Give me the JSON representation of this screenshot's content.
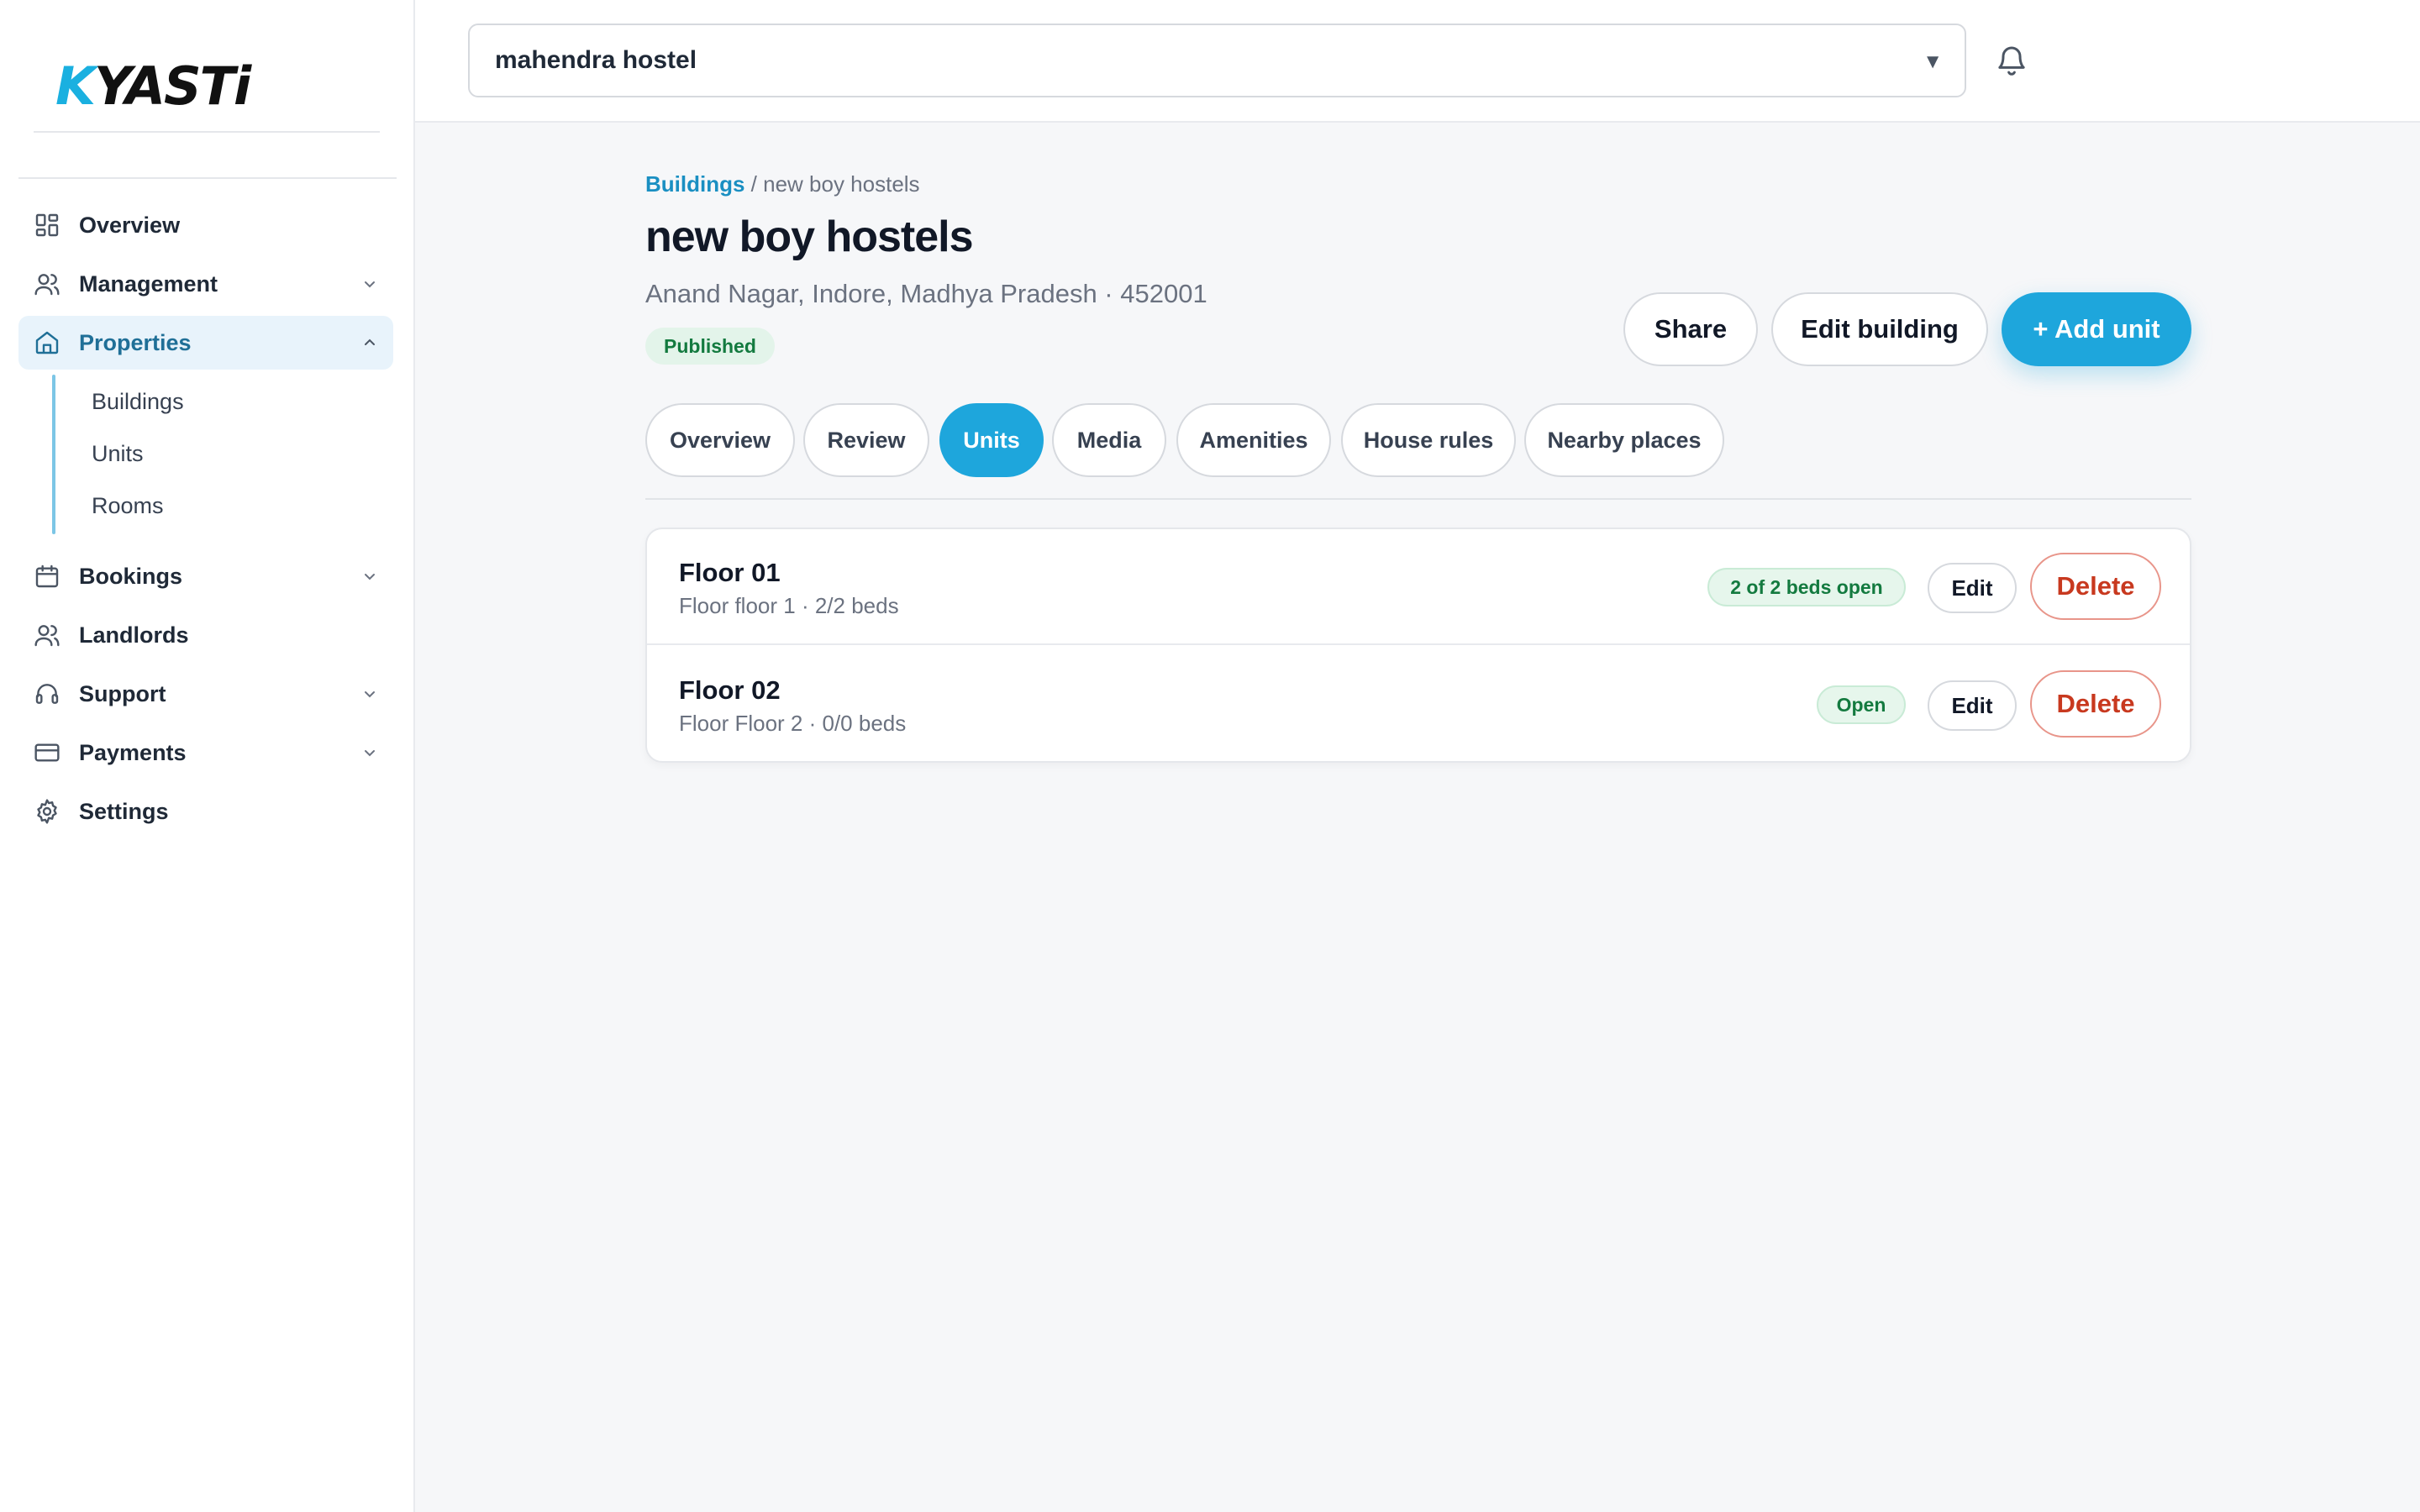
{
  "sidebar": {
    "logo_text": "KYASTi",
    "nav": {
      "overview": "Overview",
      "management": "Management",
      "properties": "Properties",
      "bookings": "Bookings",
      "landlords": "Landlords",
      "support": "Support",
      "payments": "Payments",
      "settings": "Settings"
    },
    "properties_sub": [
      "Buildings",
      "Units",
      "Rooms"
    ]
  },
  "topbar": {
    "hostel_selected": "mahendra hostel"
  },
  "breadcrumb": {
    "parent": "Buildings",
    "separator": " / ",
    "current": "new boy hostels"
  },
  "building": {
    "title": "new boy hostels",
    "address": "Anand Nagar, Indore, Madhya Pradesh · 452001",
    "status": "Published"
  },
  "actions": {
    "share": "Share",
    "edit_building": "Edit building",
    "add_unit": "+ Add unit"
  },
  "tabs": [
    "Overview",
    "Review",
    "Units",
    "Media",
    "Amenities",
    "House rules",
    "Nearby places"
  ],
  "active_tab": "Units",
  "units": [
    {
      "name": "Floor 01",
      "meta": "Floor floor 1 · 2/2 beds",
      "badge": "2 of 2 beds open",
      "edit": "Edit",
      "delete": "Delete"
    },
    {
      "name": "Floor 02",
      "meta": "Floor Floor 2 · 0/0 beds",
      "badge": "Open",
      "edit": "Edit",
      "delete": "Delete"
    }
  ],
  "colors": {
    "accent": "#1ea6dc",
    "active_nav_bg": "#e8f3fb",
    "status_green": "#137a3f",
    "danger": "#c8391f"
  },
  "icons": [
    "grid-icon",
    "users-icon",
    "home-icon",
    "calendar-icon",
    "headset-icon",
    "credit-card-icon",
    "gear-icon",
    "chevron-down-icon",
    "chevron-up-icon",
    "bell-icon",
    "caret-down-icon"
  ]
}
